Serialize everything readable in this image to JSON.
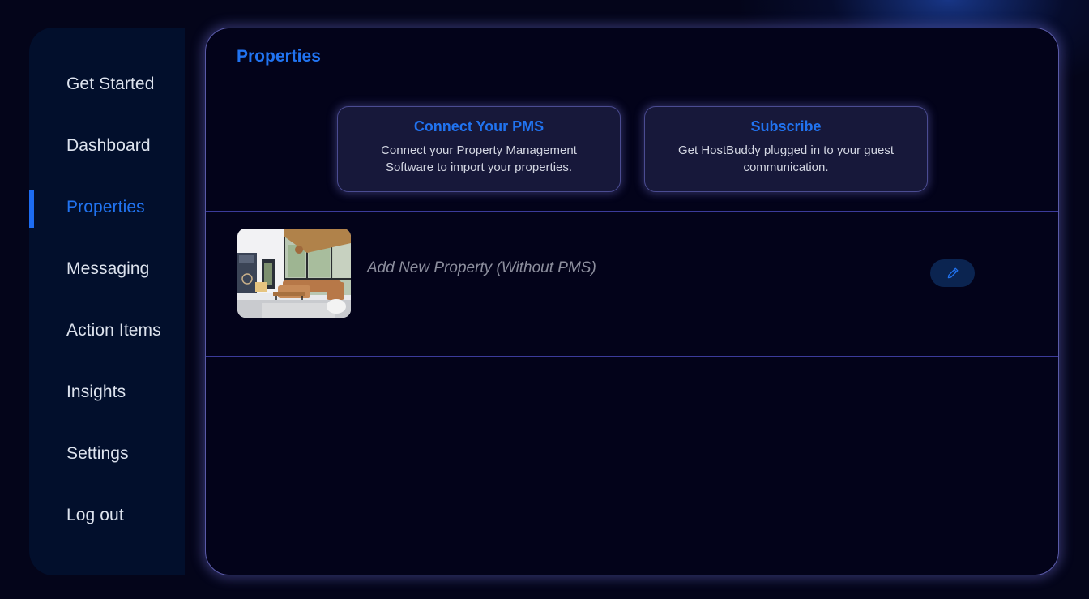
{
  "sidebar": {
    "items": [
      {
        "label": "Get Started",
        "active": false
      },
      {
        "label": "Dashboard",
        "active": false
      },
      {
        "label": "Properties",
        "active": true
      },
      {
        "label": "Messaging",
        "active": false
      },
      {
        "label": "Action Items",
        "active": false
      },
      {
        "label": "Insights",
        "active": false
      },
      {
        "label": "Settings",
        "active": false
      },
      {
        "label": "Log out",
        "active": false
      }
    ]
  },
  "header": {
    "title": "Properties"
  },
  "cards": [
    {
      "title": "Connect Your PMS",
      "description": "Connect your Property Management Software to import your properties."
    },
    {
      "title": "Subscribe",
      "description": "Get HostBuddy plugged in to your guest communication."
    }
  ],
  "properties": [
    {
      "name": "Add New Property (Without PMS)",
      "image": "living-room-photo",
      "edit_icon": "pencil-icon"
    }
  ],
  "colors": {
    "accent": "#2173f0",
    "sidebar_bg": "#020f2c",
    "main_bg": "#03031a",
    "border": "#5a5aa8"
  }
}
